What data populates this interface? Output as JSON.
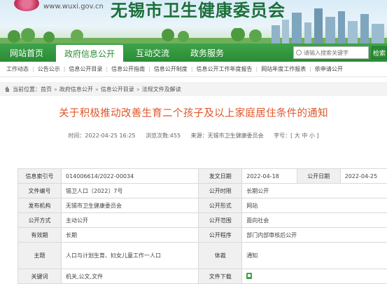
{
  "header": {
    "site_url": "www.wuxi.gov.cn",
    "site_name": "无锡市卫生健康委员会"
  },
  "nav": {
    "items": [
      "网站首页",
      "政府信息公开",
      "互动交流",
      "政务服务"
    ],
    "active_index": 1,
    "search_placeholder": "请输入搜索关键字",
    "search_button": "检索"
  },
  "subnav": {
    "items": [
      "工作动态",
      "公告公示",
      "信息公开目录",
      "信息公开指南",
      "信息公开制度",
      "信息公开工作年度报告",
      "网站年度工作报表",
      "依申请公开"
    ]
  },
  "breadcrumb": {
    "prefix": "当前位置：",
    "items": [
      "首页",
      "政府信息公开",
      "信息公开目录",
      "法规文件及解读"
    ]
  },
  "article": {
    "title": "关于积极推动改善生育二个孩子及以上家庭居住条件的通知",
    "time": "时间：2022-04-25 16:25",
    "views": "浏览次数:455",
    "source": "来源：无锡市卫生健康委员会",
    "font_size": "字号：[ 大 中 小 ]"
  },
  "info_table": {
    "rows": [
      [
        {
          "label": "信息索引号",
          "value": "014006614/2022-00034"
        },
        {
          "label": "发文日期",
          "value": "2022-04-18"
        },
        {
          "label": "公开日期",
          "value": "2022-04-25"
        }
      ],
      [
        {
          "label": "文件编号",
          "value": "锡卫人口〔2022〕7号"
        },
        {
          "label": "公开时限",
          "value": "长期公开"
        }
      ],
      [
        {
          "label": "发布机构",
          "value": "无锡市卫生健康委员会"
        },
        {
          "label": "公开形式",
          "value": "网站"
        }
      ],
      [
        {
          "label": "公开方式",
          "value": "主动公开"
        },
        {
          "label": "公开范围",
          "value": "面向社会"
        }
      ],
      [
        {
          "label": "有效期",
          "value": "长期"
        },
        {
          "label": "公开程序",
          "value": "部门内部审核后公开"
        }
      ],
      [
        {
          "label": "主题",
          "value": "人口与计划生育、妇女儿童工作一人口"
        },
        {
          "label": "体裁",
          "value": "通知"
        }
      ],
      [
        {
          "label": "关键词",
          "value": "机关,公文,文件"
        },
        {
          "label": "文件下载",
          "value": ""
        }
      ]
    ]
  },
  "colors": {
    "nav_green": "#2a8c35",
    "title_orange": "#e0562b",
    "site_name_green": "#1d6f3a"
  }
}
